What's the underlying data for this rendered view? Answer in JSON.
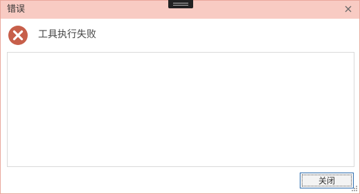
{
  "window": {
    "title": "错误",
    "close_icon": "close-icon"
  },
  "content": {
    "icon": "error-icon",
    "message": "工具执行失败",
    "details_text": ""
  },
  "buttons": {
    "close_label": "关闭"
  },
  "colors": {
    "titlebar_bg": "#f8cbc3",
    "border": "#e9a79b",
    "error_icon": "#c75f4a",
    "button_focus": "#2f6fb1"
  }
}
